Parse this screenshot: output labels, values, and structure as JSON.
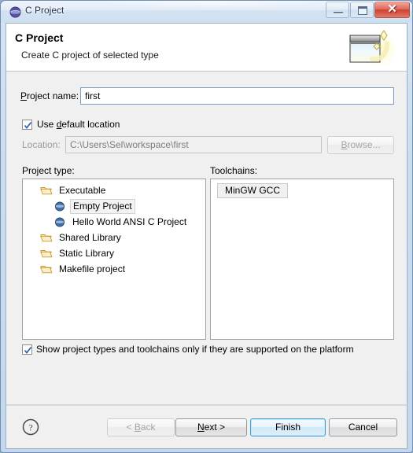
{
  "window": {
    "title": "C Project",
    "title_icon": "eclipse-icon",
    "controls": {
      "minimize": "minimize-icon",
      "maximize": "maximize-icon",
      "close": "✕"
    }
  },
  "header": {
    "title": "C Project",
    "description": "Create C project of selected type",
    "graphic": "new-project-wizard-icon"
  },
  "form": {
    "project_name_label_pre": "P",
    "project_name_label_post": "roject name:",
    "project_name_value": "first",
    "use_default_location_pre": "Use ",
    "use_default_location_mnemonic": "d",
    "use_default_location_post": "efault location",
    "use_default_location_checked": true,
    "location_label": "Location:",
    "location_value": "C:\\Users\\Sel\\workspace\\first",
    "location_disabled": true,
    "browse_pre": "B",
    "browse_mnemonic": "",
    "browse_post": "rowse..."
  },
  "project_type": {
    "label": "Project type:",
    "items": [
      {
        "label": "Executable",
        "icon": "folder-icon",
        "indent": 0,
        "selected": false
      },
      {
        "label": "Empty Project",
        "icon": "project-icon",
        "indent": 1,
        "selected": true
      },
      {
        "label": "Hello World ANSI C Project",
        "icon": "project-icon",
        "indent": 1,
        "selected": false
      },
      {
        "label": "Shared Library",
        "icon": "folder-icon",
        "indent": 0,
        "selected": false
      },
      {
        "label": "Static Library",
        "icon": "folder-icon",
        "indent": 0,
        "selected": false
      },
      {
        "label": "Makefile project",
        "icon": "folder-icon",
        "indent": 0,
        "selected": false
      }
    ]
  },
  "toolchains": {
    "label": "Toolchains:",
    "items": [
      {
        "label": "MinGW GCC",
        "selected": true
      }
    ]
  },
  "show_supported": {
    "label": "Show project types and toolchains only if they are supported on the platform",
    "checked": true
  },
  "footer": {
    "help_icon": "help-icon",
    "back_pre": "< ",
    "back_mnemonic": "B",
    "back_post": "ack",
    "back_disabled": true,
    "next_pre": "",
    "next_mnemonic": "N",
    "next_post": "ext >",
    "finish_label": "Finish",
    "finish_default": true,
    "cancel_label": "Cancel"
  },
  "colors": {
    "accent": "#3c9fd4",
    "frame": "#6f8fb5",
    "close": "#cf4030",
    "folder": "#e8b54d",
    "project_dot": "#3f6fa8"
  }
}
